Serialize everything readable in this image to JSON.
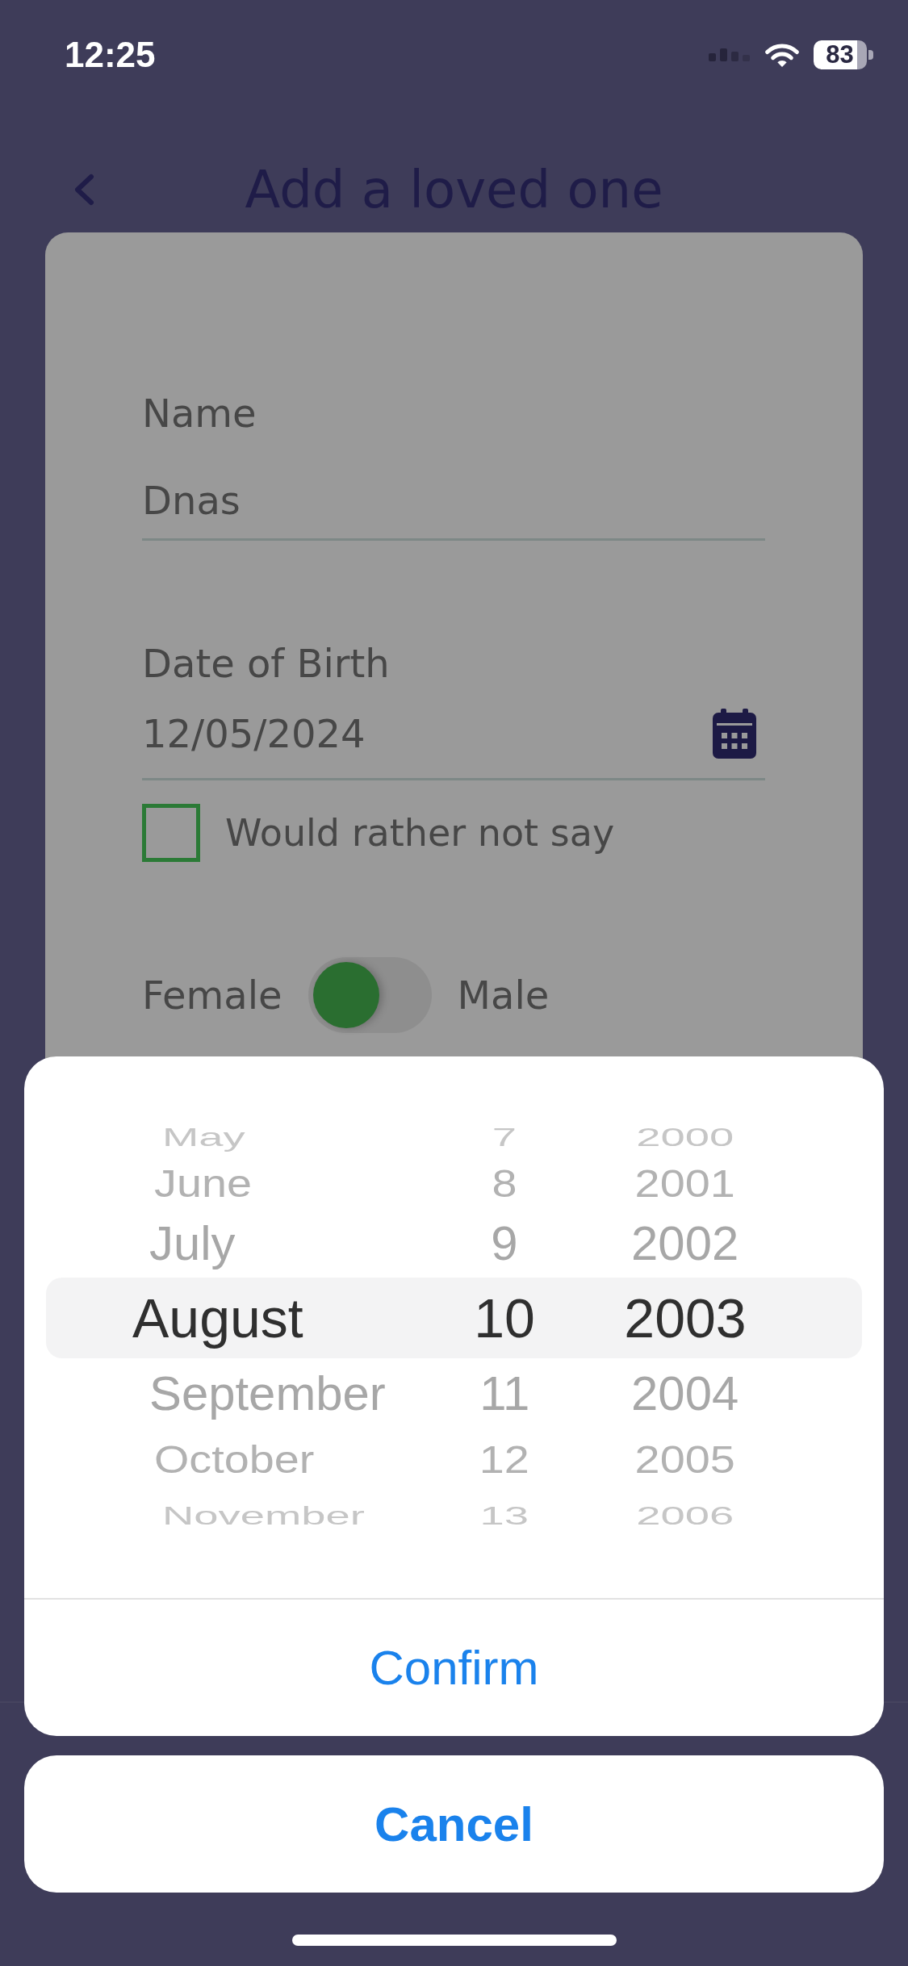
{
  "status_bar": {
    "time": "12:25",
    "battery": "83"
  },
  "header": {
    "title": "Add a loved one"
  },
  "form": {
    "fields": [
      {
        "kind": "text",
        "label": "Name",
        "value": "Dnas"
      },
      {
        "kind": "date",
        "label": "Date of Birth",
        "value": "12/05/2024"
      }
    ],
    "checkbox": {
      "label": "Would rather not say",
      "checked": false
    },
    "gender_switch": {
      "left_label": "Female",
      "right_label": "Male",
      "on": false
    }
  },
  "date_picker": {
    "columns": [
      {
        "kind": "month",
        "items": [
          {
            "label": "May",
            "selected": false
          },
          {
            "label": "June",
            "selected": false
          },
          {
            "label": "July",
            "selected": false
          },
          {
            "label": "August",
            "selected": true
          },
          {
            "label": "September",
            "selected": false
          },
          {
            "label": "October",
            "selected": false
          },
          {
            "label": "November",
            "selected": false
          }
        ]
      },
      {
        "kind": "day",
        "items": [
          {
            "label": "7",
            "selected": false
          },
          {
            "label": "8",
            "selected": false
          },
          {
            "label": "9",
            "selected": false
          },
          {
            "label": "10",
            "selected": true
          },
          {
            "label": "11",
            "selected": false
          },
          {
            "label": "12",
            "selected": false
          },
          {
            "label": "13",
            "selected": false
          }
        ]
      },
      {
        "kind": "year",
        "items": [
          {
            "label": "2000",
            "selected": false
          },
          {
            "label": "2001",
            "selected": false
          },
          {
            "label": "2002",
            "selected": false
          },
          {
            "label": "2003",
            "selected": true
          },
          {
            "label": "2004",
            "selected": false
          },
          {
            "label": "2005",
            "selected": false
          },
          {
            "label": "2006",
            "selected": false
          }
        ]
      }
    ],
    "confirm": "Confirm"
  },
  "cancel": "Cancel"
}
